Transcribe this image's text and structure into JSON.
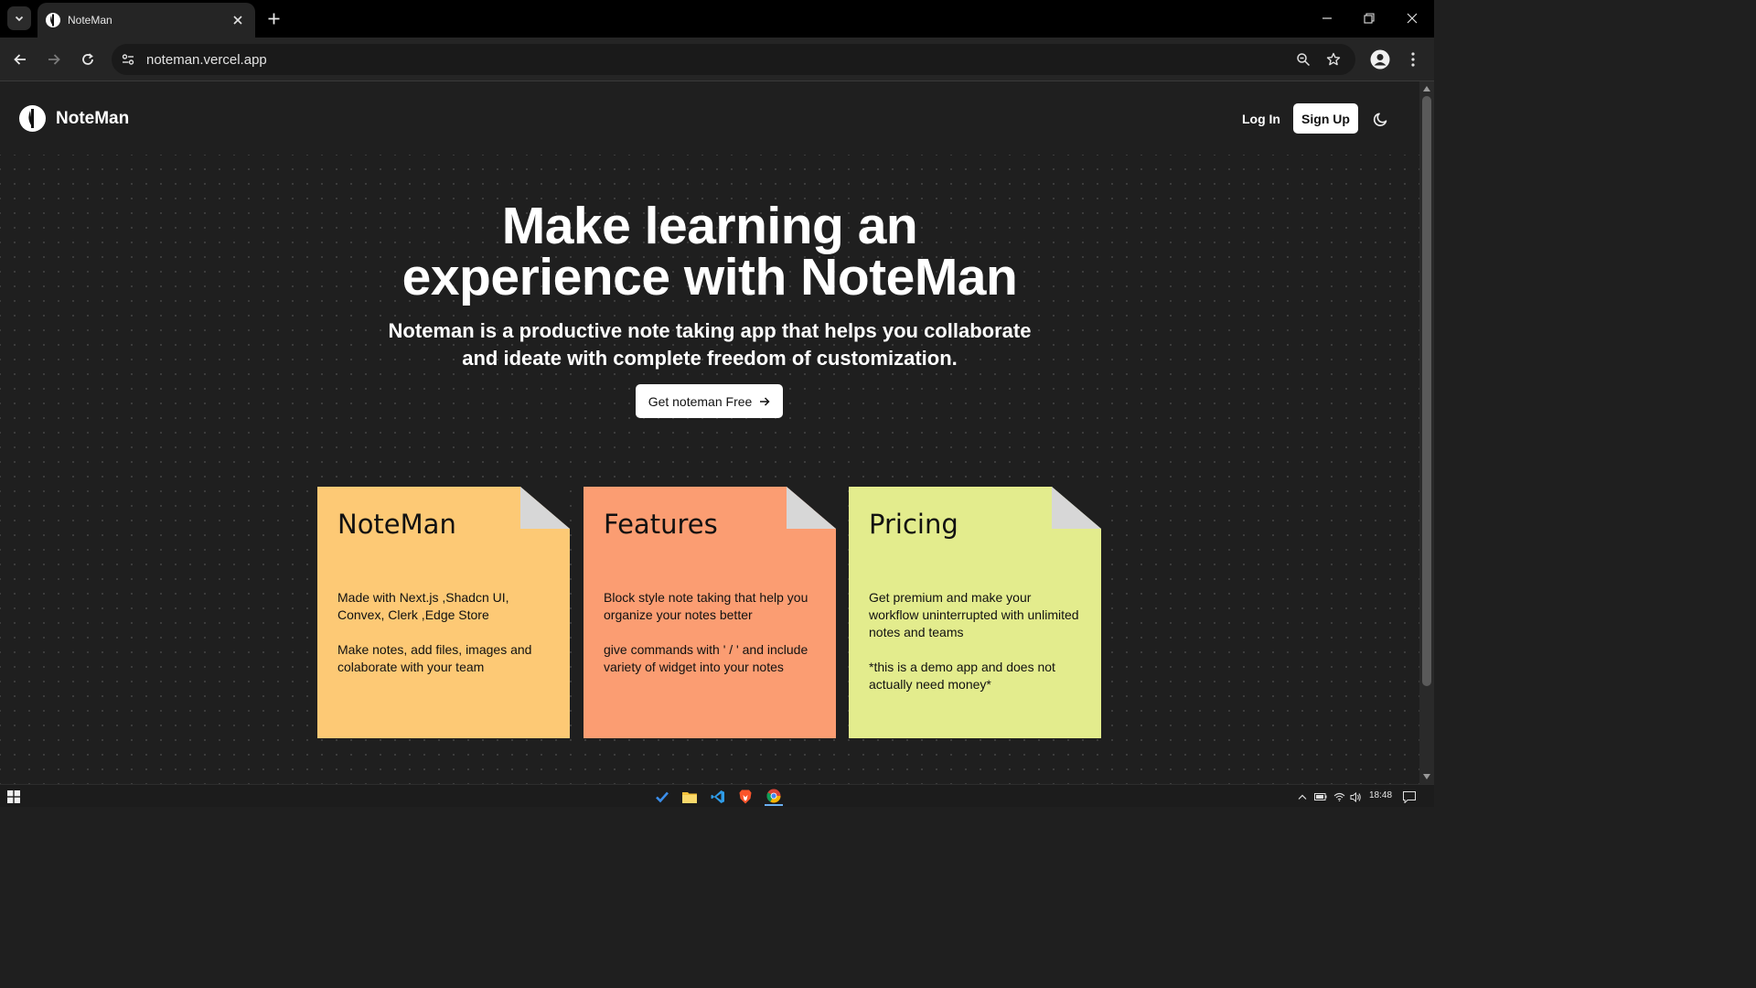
{
  "browser": {
    "tab_title": "NoteMan",
    "url": "noteman.vercel.app"
  },
  "nav": {
    "brand": "NoteMan",
    "login_label": "Log In",
    "signup_label": "Sign Up"
  },
  "hero": {
    "title": "Make learning an experience with NoteMan",
    "subtitle": "Noteman is a productive note taking app that helps you collaborate and ideate with complete freedom of customization.",
    "cta_label": "Get noteman Free"
  },
  "cards": [
    {
      "title": "NoteMan",
      "color": "#fdc975",
      "body": [
        "Made with Next.js ,Shadcn UI, Convex, Clerk ,Edge Store",
        "Make notes, add files, images and colaborate with your team"
      ]
    },
    {
      "title": "Features",
      "color": "#fb9d72",
      "body": [
        "Block style note taking that help you organize your notes better",
        "give commands with ' / ' and include variety of widget into your notes"
      ]
    },
    {
      "title": "Pricing",
      "color": "#e3ec8d",
      "body": [
        "Get premium and make your workflow uninterrupted with unlimited notes and teams",
        "*this is a demo app and does not actually need money*"
      ]
    }
  ],
  "taskbar": {
    "clock": "18:48"
  }
}
